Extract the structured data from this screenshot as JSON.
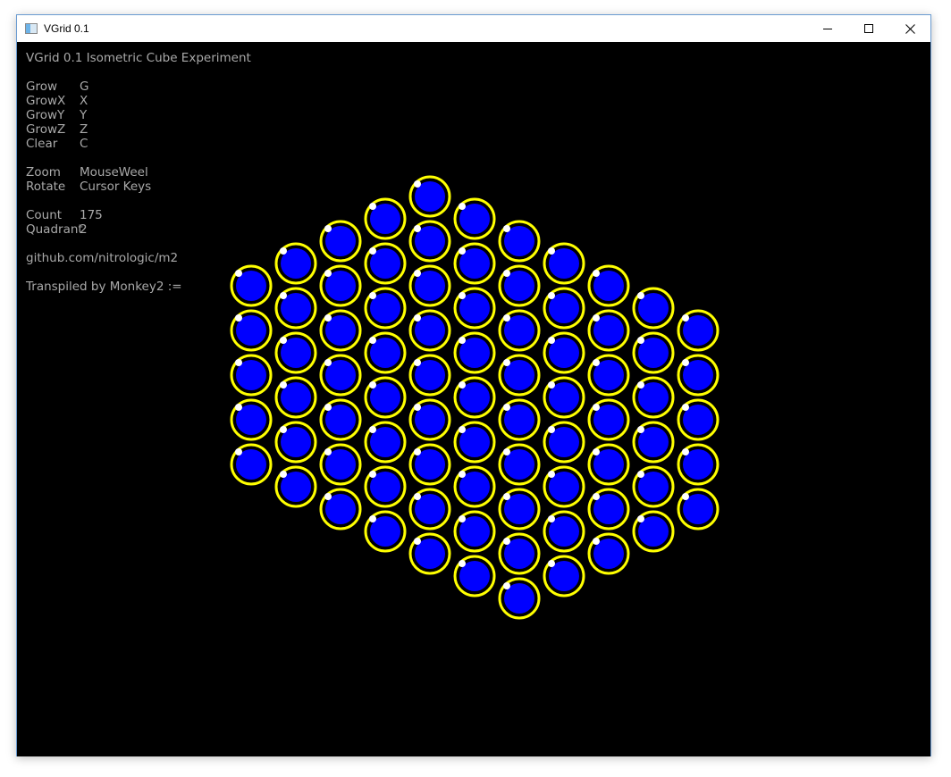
{
  "window": {
    "title": "VGrid 0.1",
    "controls": {
      "minimize": "─",
      "maximize": "☐",
      "close": "✕"
    }
  },
  "hud": {
    "heading": "VGrid 0.1 Isometric Cube Experiment",
    "keys": [
      {
        "label": "Grow",
        "value": "G"
      },
      {
        "label": "GrowX",
        "value": "X"
      },
      {
        "label": "GrowY",
        "value": "Y"
      },
      {
        "label": "GrowZ",
        "value": "Z"
      },
      {
        "label": "Clear",
        "value": "C"
      }
    ],
    "controls": [
      {
        "label": "Zoom",
        "value": "MouseWeel"
      },
      {
        "label": "Rotate",
        "value": "Cursor Keys"
      }
    ],
    "stats": [
      {
        "label": "Count",
        "value": "175"
      },
      {
        "label": "Quadrant",
        "value": "2"
      }
    ],
    "url": "github.com/nitrologic/m2",
    "footer": "Transpiled by Monkey2 :="
  },
  "scene": {
    "description_colors": {
      "ring": "#ffff00",
      "fill": "#0000ff",
      "highlight": "#ffffff",
      "background": "#000000"
    },
    "shape": "isometric-cube",
    "cube_size": [
      5,
      5,
      5
    ]
  }
}
